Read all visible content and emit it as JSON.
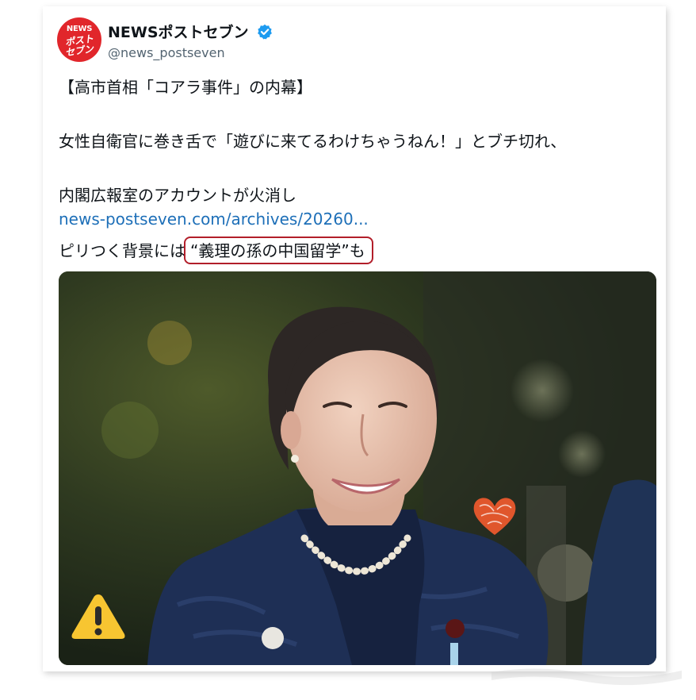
{
  "account": {
    "display_name": "NEWSポストセブン",
    "handle": "@news_postseven",
    "avatar_logo": {
      "line1": "NEWS",
      "line2": "ポスト",
      "line3": "セブン"
    },
    "verified_icon": "verified-badge-icon"
  },
  "post": {
    "title": "【高市首相「コアラ事件」の内幕】",
    "line2": "女性自衛官に巻き舌で「遊びに来てるわけちゃうねん！」とブチ切れ、",
    "line3": "内閣広報室のアカウントが火消し",
    "link": "news-postseven.com/archives/20260...",
    "line5_prefix": "ピリつく背景には",
    "line5_highlight": "“義理の孫の中国留学”も"
  },
  "overlays": {
    "heart_icon": "heart-sticker-icon",
    "warning_icon": "warning-sticker-icon"
  },
  "colors": {
    "avatar_red": "#e1262b",
    "verified_blue": "#1d9bf0",
    "link_blue": "#1d6fb8",
    "highlight_red": "#b21e2a",
    "heart_orange": "#f05a2e",
    "warning_yellow": "#f7c531"
  }
}
